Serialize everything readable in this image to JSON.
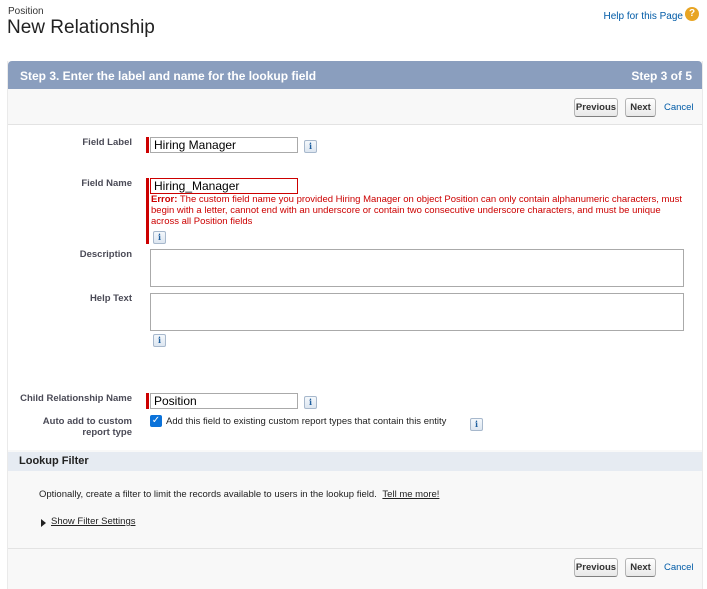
{
  "header": {
    "object_name": "Position",
    "title": "New Relationship",
    "help_link": "Help for this Page",
    "help_icon": "?"
  },
  "step": {
    "title": "Step 3. Enter the label and name for the lookup field",
    "count": "Step 3 of 5"
  },
  "buttons": {
    "previous": "Previous",
    "next": "Next",
    "cancel": "Cancel"
  },
  "form": {
    "field_label": {
      "label": "Field Label",
      "value": "Hiring Manager"
    },
    "field_name": {
      "label": "Field Name",
      "value": "Hiring_Manager",
      "error_prefix": "Error:",
      "error_message": "The custom field name you provided Hiring Manager on object Position can only contain alphanumeric characters, must begin with a letter, cannot end with an underscore or contain two consecutive underscore characters, and must be unique across all Position fields"
    },
    "description": {
      "label": "Description",
      "value": ""
    },
    "help_text": {
      "label": "Help Text",
      "value": ""
    },
    "child_relationship": {
      "label": "Child Relationship Name",
      "value": "Position"
    },
    "auto_add": {
      "label_line1": "Auto add to custom",
      "label_line2": "report type",
      "checkbox_label": "Add this field to existing custom report types that contain this entity",
      "checked": true
    },
    "info_icon": "i",
    "checkmark": "✓"
  },
  "lookup_filter": {
    "title": "Lookup Filter",
    "description": "Optionally, create a filter to limit the records available to users in the lookup field.",
    "tell_me_more": "Tell me more!",
    "show_filter_settings": "Show Filter Settings"
  },
  "colors": {
    "step_bar": "#8a9ebe",
    "required": "#cc0000",
    "error_text": "#cc0000",
    "link": "#015ba7",
    "checkbox": "#0b72d9"
  }
}
